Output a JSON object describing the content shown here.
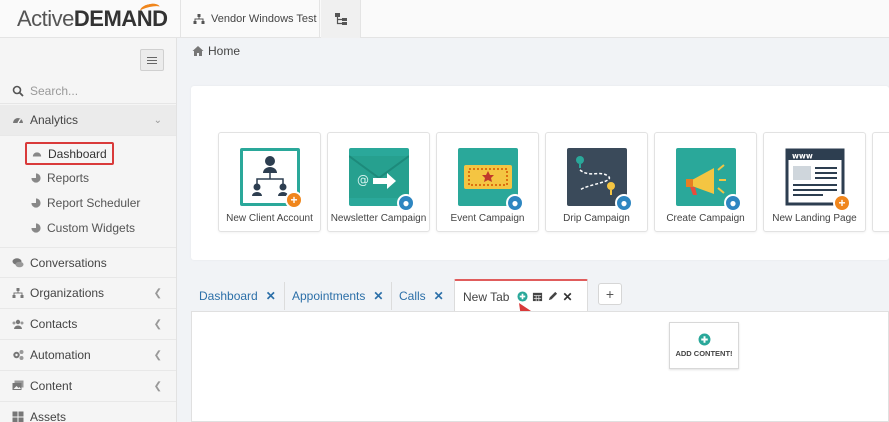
{
  "brand": {
    "name_a": "Active",
    "name_b": "DEMAND",
    "accent": "#f0861c"
  },
  "workspace": {
    "tab_label": "Vendor Windows Test"
  },
  "sidebar": {
    "search_placeholder": "Search...",
    "analytics": {
      "label": "Analytics",
      "items": [
        {
          "label": "Dashboard",
          "active": true
        },
        {
          "label": "Reports"
        },
        {
          "label": "Report Scheduler"
        },
        {
          "label": "Custom Widgets"
        }
      ]
    },
    "items": [
      {
        "label": "Conversations"
      },
      {
        "label": "Organizations"
      },
      {
        "label": "Contacts"
      },
      {
        "label": "Automation"
      },
      {
        "label": "Content"
      },
      {
        "label": "Assets"
      }
    ]
  },
  "breadcrumb": {
    "home": "Home"
  },
  "quick_actions": [
    {
      "label": "New Client Account",
      "icon": "org-chart-icon",
      "color": "#2aa89a",
      "badge": "orange"
    },
    {
      "label": "Newsletter Campaign",
      "icon": "envelope-icon",
      "color": "#2aa89a",
      "badge": "blue"
    },
    {
      "label": "Event Campaign",
      "icon": "ticket-icon",
      "color": "#2aa89a",
      "badge": "blue"
    },
    {
      "label": "Drip Campaign",
      "icon": "route-icon",
      "color": "#3a4a5a",
      "badge": "blue"
    },
    {
      "label": "Create Campaign",
      "icon": "megaphone-icon",
      "color": "#2aa89a",
      "badge": "blue"
    },
    {
      "label": "New Landing Page",
      "icon": "browser-icon",
      "color": "#ffffff",
      "badge": "orange"
    }
  ],
  "tabs": [
    {
      "label": "Dashboard"
    },
    {
      "label": "Appointments"
    },
    {
      "label": "Calls"
    },
    {
      "label": "New Tab",
      "active": true
    }
  ],
  "add_tab_label": "+",
  "add_content_label": "ADD CONTENT!"
}
